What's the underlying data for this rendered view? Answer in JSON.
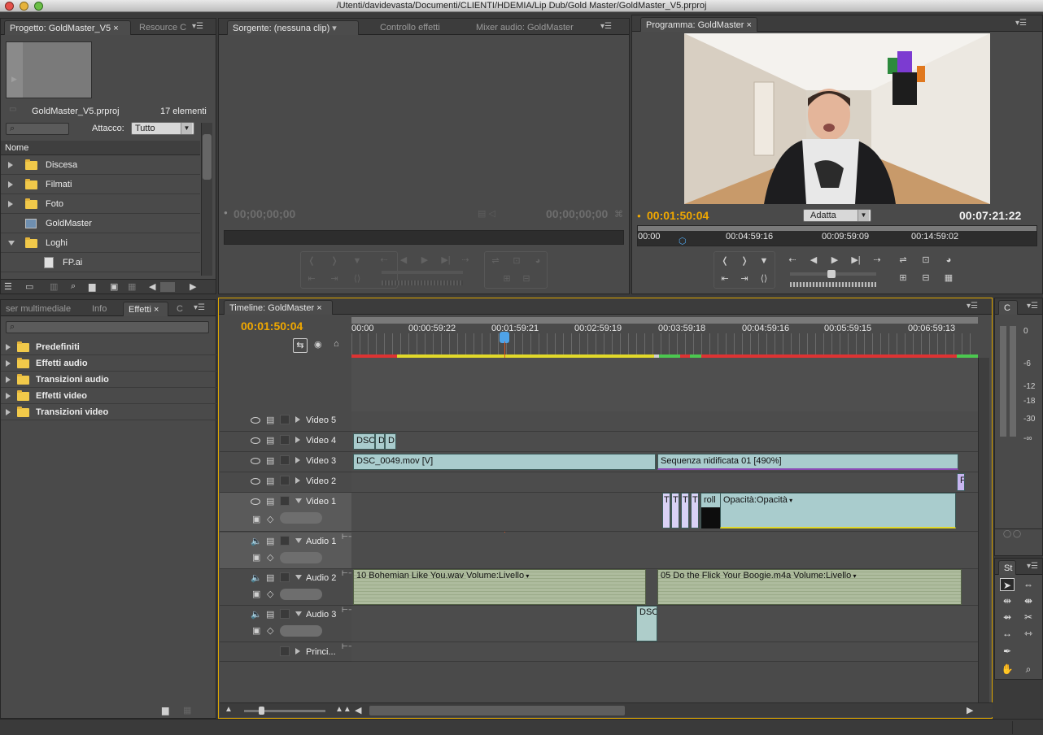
{
  "window": {
    "title": "/Utenti/davidevasta/Documenti/CLIENTI/HDEMIA/Lip Dub/Gold Master/GoldMaster_V5.prproj"
  },
  "project": {
    "tab_active": "Progetto: GoldMaster_V5",
    "tab_other": "Resource C",
    "filename": "GoldMaster_V5.prproj",
    "count": "17 elementi",
    "attacco_label": "Attacco:",
    "attacco_value": "Tutto",
    "column_name": "Nome",
    "items": [
      {
        "label": "Discesa",
        "kind": "folder"
      },
      {
        "label": "Filmati",
        "kind": "folder"
      },
      {
        "label": "Foto",
        "kind": "folder"
      },
      {
        "label": "GoldMaster",
        "kind": "sequence"
      },
      {
        "label": "Loghi",
        "kind": "folder"
      },
      {
        "label": "FP.ai",
        "kind": "file"
      }
    ]
  },
  "source": {
    "tab_active": "Sorgente: (nessuna clip)",
    "tab_effects": "Controllo effetti",
    "tab_mixer": "Mixer audio: GoldMaster",
    "tc_left": "00;00;00;00",
    "tc_right": "00;00;00;00"
  },
  "program": {
    "tab": "Programma: GoldMaster",
    "tc_current": "00:01:50:04",
    "tc_duration": "00:07:21:22",
    "fit": "Adatta",
    "ruler": [
      "00:00",
      "00:04:59:16",
      "00:09:59:09",
      "00:14:59:02"
    ]
  },
  "effects_panel": {
    "tab_browser": "ser multimediale",
    "tab_info": "Info",
    "tab_effects": "Effetti",
    "tab_more": "C",
    "items": [
      "Predefiniti",
      "Effetti audio",
      "Transizioni audio",
      "Effetti video",
      "Transizioni video"
    ]
  },
  "timeline": {
    "tab": "Timeline: GoldMaster",
    "tc": "00:01:50:04",
    "ruler": [
      "00:00",
      "00:00:59:22",
      "00:01:59:21",
      "00:02:59:19",
      "00:03:59:18",
      "00:04:59:16",
      "00:05:59:15",
      "00:06:59:13"
    ],
    "video_tracks": [
      "Video 5",
      "Video 4",
      "Video 3",
      "Video 2",
      "Video 1"
    ],
    "audio_tracks": [
      "Audio 1",
      "Audio 2",
      "Audio 3"
    ],
    "master_track": "Princi...",
    "clips": {
      "v4_a": "DSC",
      "v4_b": "D",
      "v4_c": "D!",
      "v3_a": "DSC_0049.mov [V]",
      "v3_b": "Sequenza nidificata 01 [490%]",
      "v2_a": "F",
      "v1_t1": "T",
      "v1_t2": "T",
      "v1_t3": "T",
      "v1_t4": "T",
      "v1_roll": "roll",
      "v1_opacity": "Opacità:Opacità",
      "a2_a": "10 Bohemian Like You.wav",
      "a2_a_fx": "Volume:Livello",
      "a2_b": "05 Do the Flick Your Boogie.m4a",
      "a2_b_fx": "Volume:Livello",
      "a3_a": "DSC"
    }
  },
  "meters": {
    "tab": "C",
    "labels": [
      "0",
      "-6",
      "-12",
      "-18",
      "-30",
      "-∞"
    ]
  },
  "tools": {
    "tab": "St"
  }
}
